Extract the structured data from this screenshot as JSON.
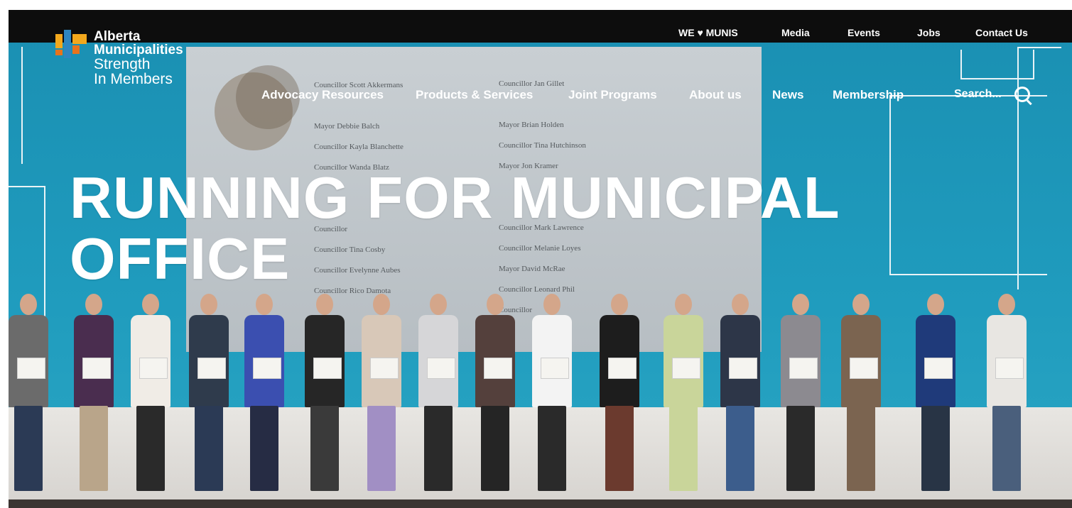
{
  "brand": {
    "name_line1": "Alberta",
    "name_line2": "Municipalities",
    "tagline_line1": "Strength",
    "tagline_line2": "In Members"
  },
  "utility_nav": [
    "WE ♥ MUNIS",
    "Media",
    "Events",
    "Jobs",
    "Contact Us"
  ],
  "main_nav": [
    "Advocacy Resources",
    "Products & Services",
    "Joint Programs",
    "About us",
    "News",
    "Membership"
  ],
  "search": {
    "label": "Search..."
  },
  "hero": {
    "line1": "RUNNING FOR MUNICIPAL",
    "line2": "OFFICE"
  },
  "screen_names_left": [
    "Councillor Scott Akkermans",
    "",
    "Mayor Debbie Balch",
    "Councillor Kayla Blanchette",
    "Councillor Wanda Blatz",
    "",
    "",
    "Councillor",
    "Councillor Tina Cosby",
    "Councillor Evelynne Aubes",
    "Councillor Rico Damota"
  ],
  "screen_names_right": [
    "Councillor Jan Gillet",
    "",
    "Mayor Brian Holden",
    "Councillor Tina Hutchinson",
    "Mayor Jon Kramer",
    "",
    "",
    "Councillor Mark Lawrence",
    "Councillor Melanie Loyes",
    "Mayor David McRae",
    "Councillor Leonard Phil",
    "Councillor"
  ],
  "colors": {
    "topbar": "#0d0d0d",
    "sky": "#1f9bbd",
    "text": "#ffffff",
    "logo_yellow": "#f2a81d",
    "logo_blue": "#2e86c1",
    "logo_orange": "#e8731c"
  }
}
